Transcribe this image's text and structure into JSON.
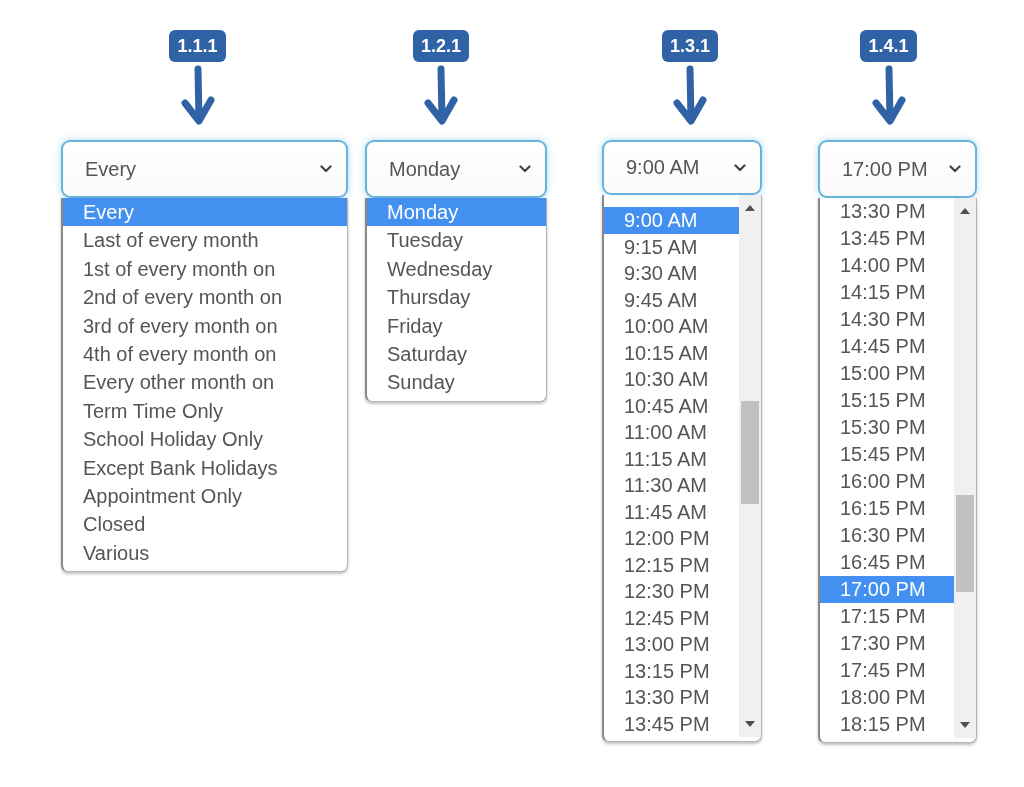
{
  "dropdowns": [
    {
      "step": "1.1.1",
      "value": "Every",
      "kind": "plain",
      "options": [
        {
          "label": "Every",
          "selected": true
        },
        {
          "label": "Last of every month",
          "selected": false
        },
        {
          "label": "1st of every month on",
          "selected": false
        },
        {
          "label": "2nd of every month on",
          "selected": false
        },
        {
          "label": "3rd of every month on",
          "selected": false
        },
        {
          "label": "4th of every month on",
          "selected": false
        },
        {
          "label": "Every other month on",
          "selected": false
        },
        {
          "label": "Term Time Only",
          "selected": false
        },
        {
          "label": "School Holiday Only",
          "selected": false
        },
        {
          "label": "Except Bank Holidays",
          "selected": false
        },
        {
          "label": "Appointment Only",
          "selected": false
        },
        {
          "label": "Closed",
          "selected": false
        },
        {
          "label": "Various",
          "selected": false
        }
      ]
    },
    {
      "step": "1.2.1",
      "value": "Monday",
      "kind": "plain",
      "options": [
        {
          "label": "Monday",
          "selected": true
        },
        {
          "label": "Tuesday",
          "selected": false
        },
        {
          "label": "Wednesday",
          "selected": false
        },
        {
          "label": "Thursday",
          "selected": false
        },
        {
          "label": "Friday",
          "selected": false
        },
        {
          "label": "Saturday",
          "selected": false
        },
        {
          "label": "Sunday",
          "selected": false
        }
      ]
    },
    {
      "step": "1.3.1",
      "value": "9:00 AM",
      "kind": "scrolling",
      "options": [
        {
          "label": "9:00 AM",
          "selected": true
        },
        {
          "label": "9:15 AM",
          "selected": false
        },
        {
          "label": "9:30 AM",
          "selected": false
        },
        {
          "label": "9:45 AM",
          "selected": false
        },
        {
          "label": "10:00 AM",
          "selected": false
        },
        {
          "label": "10:15 AM",
          "selected": false
        },
        {
          "label": "10:30 AM",
          "selected": false
        },
        {
          "label": "10:45 AM",
          "selected": false
        },
        {
          "label": "11:00 AM",
          "selected": false
        },
        {
          "label": "11:15 AM",
          "selected": false
        },
        {
          "label": "11:30 AM",
          "selected": false
        },
        {
          "label": "11:45 AM",
          "selected": false
        },
        {
          "label": "12:00 PM",
          "selected": false
        },
        {
          "label": "12:15 PM",
          "selected": false
        },
        {
          "label": "12:30 PM",
          "selected": false
        },
        {
          "label": "12:45 PM",
          "selected": false
        },
        {
          "label": "13:00 PM",
          "selected": false
        },
        {
          "label": "13:15 PM",
          "selected": false
        },
        {
          "label": "13:30 PM",
          "selected": false
        },
        {
          "label": "13:45 PM",
          "selected": false
        }
      ]
    },
    {
      "step": "1.4.1",
      "value": "17:00 PM",
      "kind": "scrolling",
      "options": [
        {
          "label": "13:30 PM",
          "selected": false
        },
        {
          "label": "13:45 PM",
          "selected": false
        },
        {
          "label": "14:00 PM",
          "selected": false
        },
        {
          "label": "14:15 PM",
          "selected": false
        },
        {
          "label": "14:30 PM",
          "selected": false
        },
        {
          "label": "14:45 PM",
          "selected": false
        },
        {
          "label": "15:00 PM",
          "selected": false
        },
        {
          "label": "15:15 PM",
          "selected": false
        },
        {
          "label": "15:30 PM",
          "selected": false
        },
        {
          "label": "15:45 PM",
          "selected": false
        },
        {
          "label": "16:00 PM",
          "selected": false
        },
        {
          "label": "16:15 PM",
          "selected": false
        },
        {
          "label": "16:30 PM",
          "selected": false
        },
        {
          "label": "16:45 PM",
          "selected": false
        },
        {
          "label": "17:00 PM",
          "selected": true
        },
        {
          "label": "17:15 PM",
          "selected": false
        },
        {
          "label": "17:30 PM",
          "selected": false
        },
        {
          "label": "17:45 PM",
          "selected": false
        },
        {
          "label": "18:00 PM",
          "selected": false
        },
        {
          "label": "18:15 PM",
          "selected": false
        }
      ]
    }
  ]
}
